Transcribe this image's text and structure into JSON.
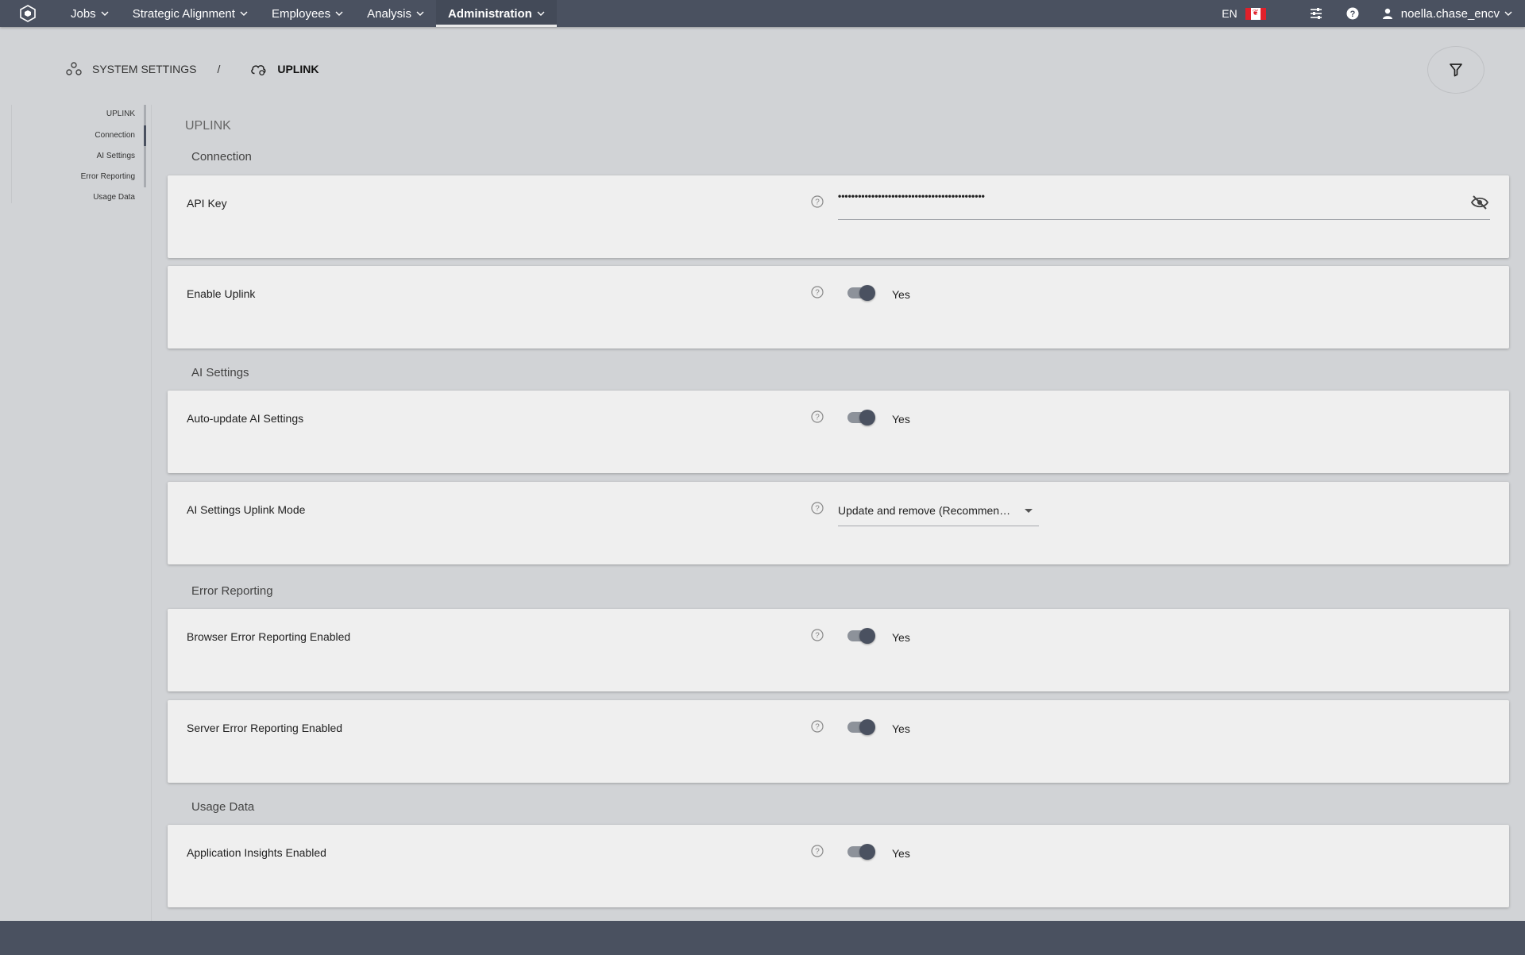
{
  "topbar": {
    "nav": [
      {
        "label": "Jobs"
      },
      {
        "label": "Strategic Alignment"
      },
      {
        "label": "Employees"
      },
      {
        "label": "Analysis"
      },
      {
        "label": "Administration"
      }
    ],
    "active_nav": "Administration",
    "language": "EN",
    "username": "noella.chase_encv"
  },
  "breadcrumb": {
    "parent": "SYSTEM SETTINGS",
    "separator": "/",
    "current": "UPLINK"
  },
  "toc": {
    "items": [
      "UPLINK",
      "Connection",
      "AI Settings",
      "Error Reporting",
      "Usage Data"
    ]
  },
  "main": {
    "heading": "UPLINK",
    "sections": {
      "connection": "Connection",
      "ai": "AI Settings",
      "error": "Error Reporting",
      "usage": "Usage Data"
    },
    "api_key": {
      "label": "API Key",
      "masked_value": "••••••••••••••••••••••••••••••••••••••••••••"
    },
    "enable_uplink": {
      "label": "Enable Uplink",
      "value": "Yes"
    },
    "auto_update_ai": {
      "label": "Auto-update AI Settings",
      "value": "Yes"
    },
    "ai_uplink_mode": {
      "label": "AI Settings Uplink Mode",
      "value": "Update and remove (Recommended)"
    },
    "browser_error": {
      "label": "Browser Error Reporting Enabled",
      "value": "Yes"
    },
    "server_error": {
      "label": "Server Error Reporting Enabled",
      "value": "Yes"
    },
    "app_insights": {
      "label": "Application Insights Enabled",
      "value": "Yes"
    }
  },
  "colors": {
    "topbar": "#4a5160",
    "background": "#d1d3d6",
    "card": "#efefef",
    "toggle_knob": "#4a5160",
    "flag_red": "#e0202a"
  },
  "icons": {
    "logo": "hexagon-logo-icon",
    "settings": "sliders-icon",
    "help": "question-circle-icon",
    "user": "user-icon",
    "system_settings": "system-settings-icon",
    "uplink": "cloud-sync-icon",
    "filter": "filter-icon",
    "visibility": "eye-off-icon"
  }
}
